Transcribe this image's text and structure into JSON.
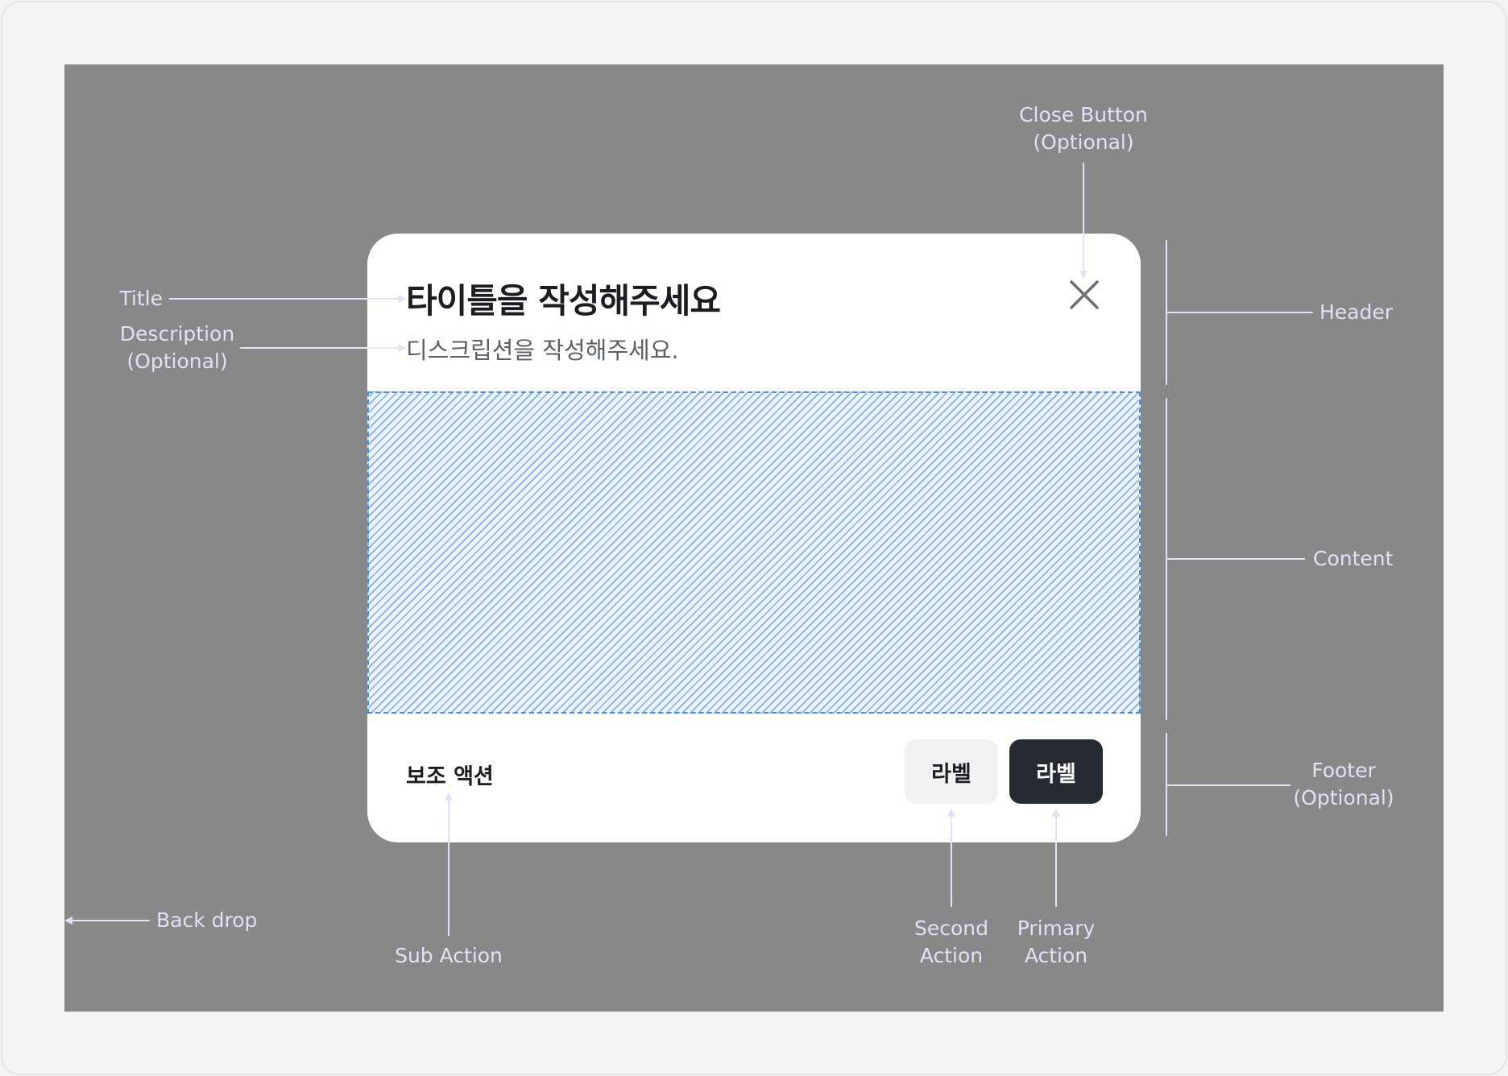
{
  "modal": {
    "title": "타이틀을 작성해주세요",
    "description": "디스크립션을 작성해주세요.",
    "sub_action_label": "보조 액션",
    "second_action_label": "라벨",
    "primary_action_label": "라벨"
  },
  "annotations": {
    "title": "Title",
    "description_line1": "Description",
    "description_line2": "(Optional)",
    "close_line1": "Close Button",
    "close_line2": "(Optional)",
    "header": "Header",
    "content": "Content",
    "footer_line1": "Footer",
    "footer_line2": "(Optional)",
    "backdrop": "Back drop",
    "sub_action": "Sub Action",
    "second_line1": "Second",
    "second_line2": "Action",
    "primary_line1": "Primary",
    "primary_line2": "Action"
  },
  "colors": {
    "backdrop": "#888888",
    "annotation": "#e4e0f7",
    "primary_button": "#262b33",
    "second_button": "#f1f2f4",
    "content_hatch": "#8fb8f0",
    "content_border": "#4a8fe6"
  },
  "icons": {
    "close": "close-icon"
  }
}
